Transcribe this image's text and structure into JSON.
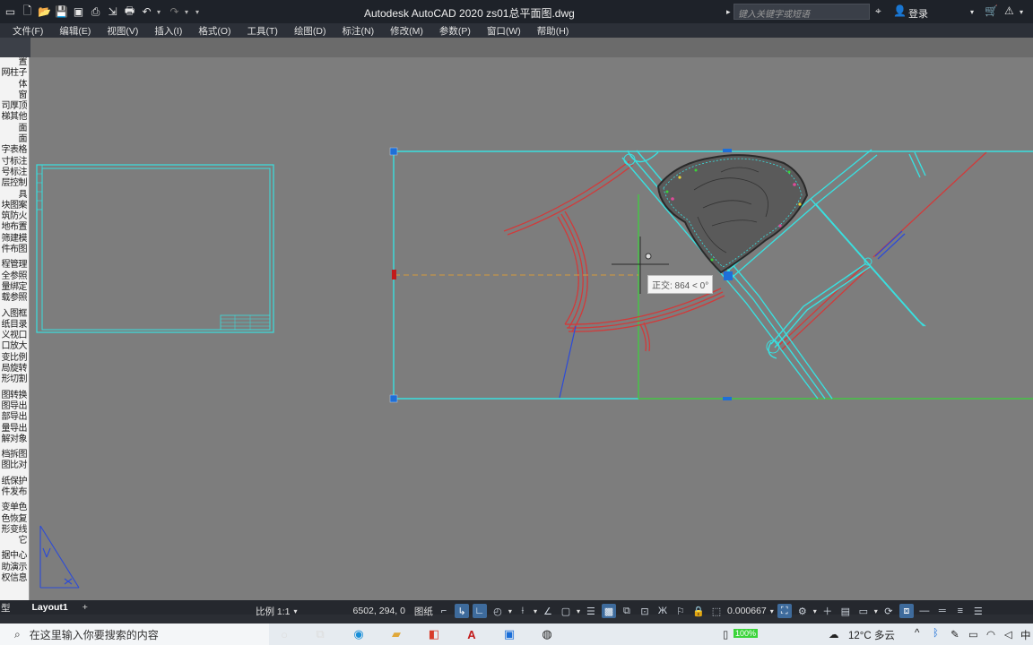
{
  "window": {
    "title": "Autodesk AutoCAD 2020    zs01总平面图.dwg",
    "search_placeholder": "键入关键字或短语",
    "login_label": "登录"
  },
  "menu": [
    "文件(F)",
    "编辑(E)",
    "视图(V)",
    "插入(I)",
    "格式(O)",
    "工具(T)",
    "绘图(D)",
    "标注(N)",
    "修改(M)",
    "参数(P)",
    "窗口(W)",
    "帮助(H)"
  ],
  "palette": {
    "groups": [
      [
        "置",
        "网柱子",
        "体",
        "窗",
        "司厚顶",
        "梯其他",
        "面",
        "面",
        "字表格",
        "寸标注",
        "号标注",
        "层控制",
        "具",
        "块图案",
        "筑防火",
        "地布置",
        "筛建模",
        "件布图"
      ],
      [
        "程管理",
        "全参照",
        "量绑定",
        "载参照"
      ],
      [
        "入图框",
        "纸目录",
        "义视口",
        "口放大",
        "变比例",
        "局旋转",
        "形切割"
      ],
      [
        "图转换",
        "图导出",
        "部导出",
        "量导出",
        "解对象"
      ],
      [
        "档拆图",
        "图比对"
      ],
      [
        "纸保护",
        "件发布"
      ],
      [
        "变单色",
        "色恢复",
        "形变线",
        "它"
      ],
      [
        "据中心",
        "助演示",
        "权信息"
      ]
    ]
  },
  "canvas": {
    "tooltip": "正交: 864 < 0°"
  },
  "layout_tabs": {
    "model_label": "型",
    "active_tab": "Layout1",
    "add_label": "+"
  },
  "status": {
    "scale": "比例 1:1",
    "coords": "6502, 294, 0",
    "paper": "图纸",
    "annotation_scale": "0.000667"
  },
  "taskbar": {
    "search_placeholder": "在这里输入你要搜索的内容",
    "battery": "100%",
    "weather": "12°C  多云",
    "ime": "中"
  },
  "colors": {
    "cyan_lines": "#39e0e0",
    "red_lines": "#d23a3a",
    "green_line": "#3ad43a",
    "grip_blue": "#1e6fd8"
  }
}
